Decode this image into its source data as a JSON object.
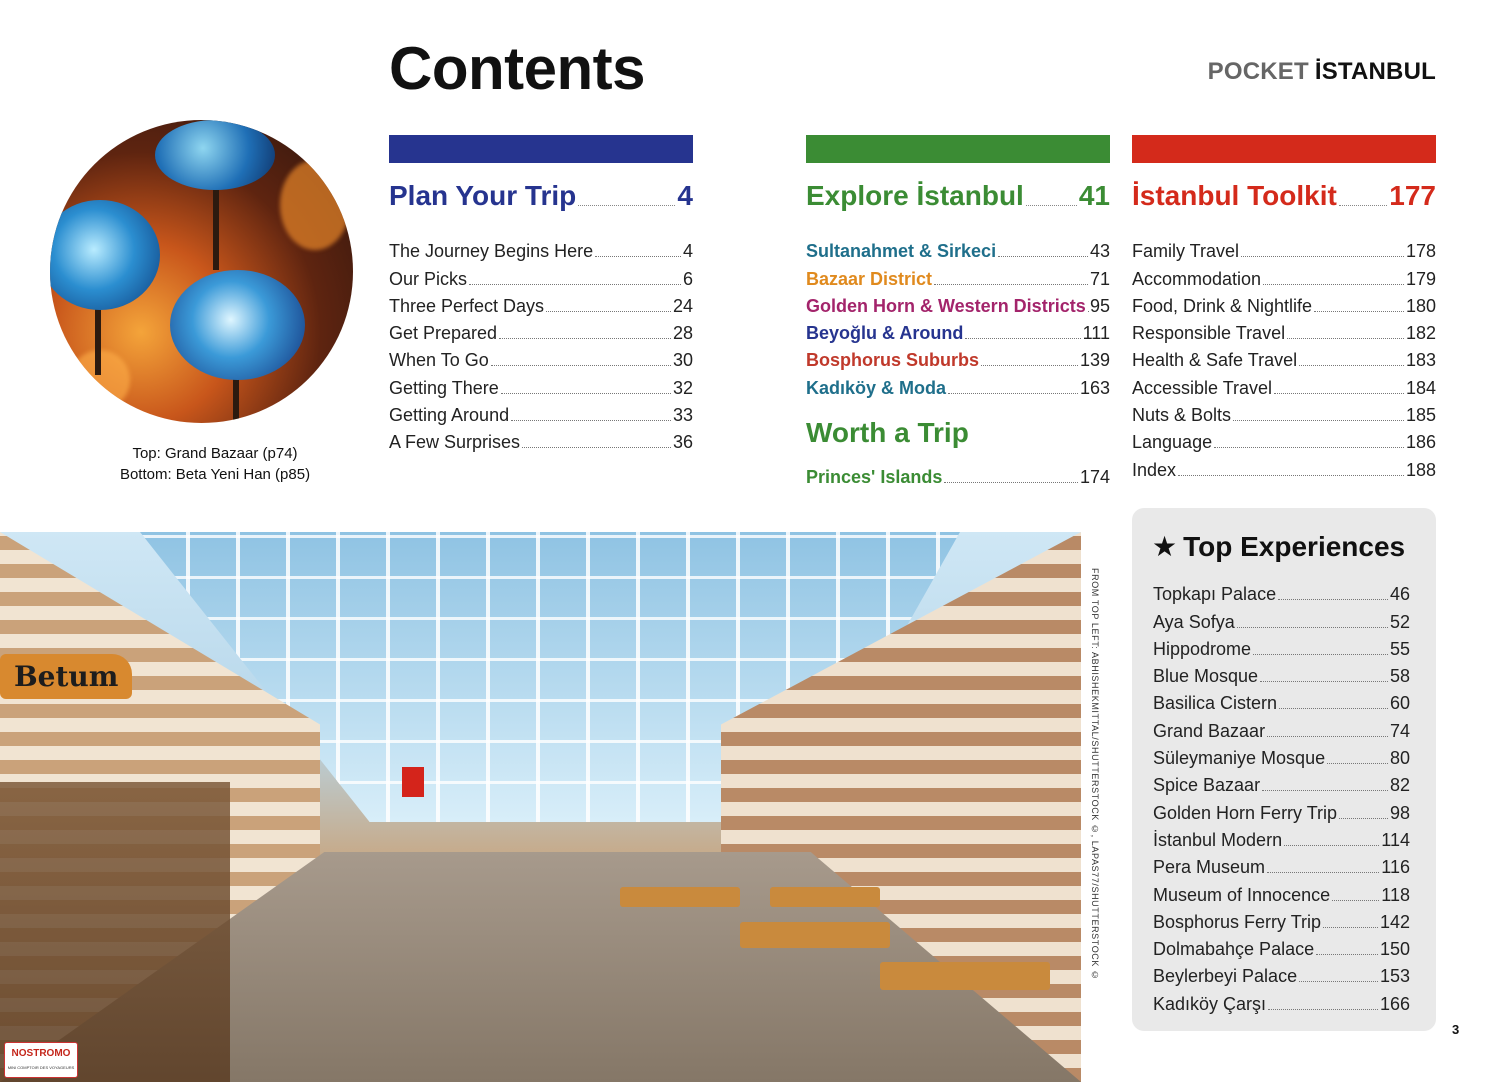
{
  "header": {
    "title": "Contents",
    "brand_prefix": "POCKET",
    "brand_name": "İSTANBUL"
  },
  "photo_caption": {
    "line1": "Top: Grand Bazaar (p74)",
    "line2": "Bottom: Beta Yeni Han (p85)"
  },
  "photo_signs": {
    "betum": "Betum"
  },
  "colors": {
    "plan": "#26348f",
    "explore": "#3b8c34",
    "toolkit": "#d42a1b",
    "sultanahmet": "#1f6f8b",
    "bazaar": "#e08a1e",
    "golden_horn": "#a3246b",
    "beyoglu": "#26348f",
    "bosphorus": "#c0392b",
    "kadikoy": "#1f6f8b",
    "princes": "#3b8c34"
  },
  "plan": {
    "title": "Plan Your Trip",
    "page": "4",
    "items": [
      {
        "t": "The Journey Begins Here",
        "n": "4"
      },
      {
        "t": "Our Picks",
        "n": "6"
      },
      {
        "t": "Three Perfect Days",
        "n": "24"
      },
      {
        "t": "Get Prepared",
        "n": "28"
      },
      {
        "t": "When To Go",
        "n": "30"
      },
      {
        "t": "Getting There",
        "n": "32"
      },
      {
        "t": "Getting Around",
        "n": "33"
      },
      {
        "t": "A Few Surprises",
        "n": "36"
      }
    ]
  },
  "explore": {
    "title": "Explore İstanbul",
    "page": "41",
    "items": [
      {
        "t": "Sultanahmet & Sirkeci",
        "n": "43"
      },
      {
        "t": "Bazaar District",
        "n": "71"
      },
      {
        "t": "Golden Horn & Western Districts",
        "n": "95"
      },
      {
        "t": "Beyoğlu & Around",
        "n": "111"
      },
      {
        "t": "Bosphorus Suburbs",
        "n": "139"
      },
      {
        "t": "Kadıköy & Moda",
        "n": "163"
      }
    ]
  },
  "worth": {
    "title": "Worth a Trip",
    "items": [
      {
        "t": "Princes' Islands",
        "n": "174"
      }
    ]
  },
  "toolkit": {
    "title": "İstanbul Toolkit",
    "page": "177",
    "items": [
      {
        "t": "Family Travel",
        "n": "178"
      },
      {
        "t": "Accommodation",
        "n": "179"
      },
      {
        "t": "Food, Drink & Nightlife",
        "n": "180"
      },
      {
        "t": "Responsible Travel",
        "n": "182"
      },
      {
        "t": "Health & Safe Travel",
        "n": "183"
      },
      {
        "t": "Accessible Travel",
        "n": "184"
      },
      {
        "t": "Nuts & Bolts",
        "n": "185"
      },
      {
        "t": "Language",
        "n": "186"
      },
      {
        "t": "Index",
        "n": "188"
      }
    ]
  },
  "top_experiences": {
    "star": "★",
    "title": "Top Experiences",
    "items": [
      {
        "t": "Topkapı Palace",
        "n": "46"
      },
      {
        "t": "Aya Sofya",
        "n": "52"
      },
      {
        "t": "Hippodrome",
        "n": "55"
      },
      {
        "t": "Blue Mosque",
        "n": "58"
      },
      {
        "t": "Basilica Cistern",
        "n": "60"
      },
      {
        "t": "Grand Bazaar",
        "n": "74"
      },
      {
        "t": "Süleymaniye Mosque",
        "n": "80"
      },
      {
        "t": "Spice Bazaar",
        "n": "82"
      },
      {
        "t": "Golden Horn Ferry Trip",
        "n": "98"
      },
      {
        "t": "İstanbul Modern",
        "n": "114"
      },
      {
        "t": "Pera Museum",
        "n": "116"
      },
      {
        "t": "Museum of Innocence",
        "n": "118"
      },
      {
        "t": "Bosphorus Ferry Trip",
        "n": "142"
      },
      {
        "t": "Dolmabahçe Palace",
        "n": "150"
      },
      {
        "t": "Beylerbeyi Palace",
        "n": "153"
      },
      {
        "t": "Kadıköy Çarşı",
        "n": "166"
      }
    ]
  },
  "photo_credit": "FROM TOP LEFT: ABHISHEKMITTAL/SHUTTERSTOCK ©, LAPAS77/SHUTTERSTOCK ©",
  "page_number": "3",
  "watermark": {
    "name": "NOSTROMO",
    "tagline": "MINI COMPTOIR DES VOYAGEURS"
  }
}
